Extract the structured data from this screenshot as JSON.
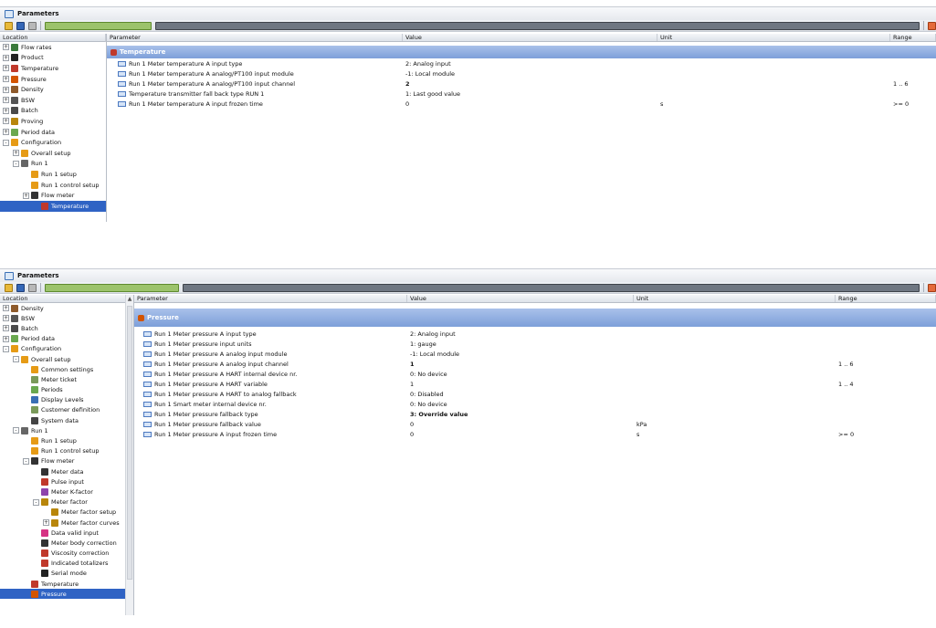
{
  "panels": [
    {
      "title": "Parameters",
      "tree_header": "Location",
      "tree_items": [
        {
          "label": "Flow rates",
          "level": 0,
          "expander": "+",
          "icon": "flow-icon",
          "color": "#3b7a3b"
        },
        {
          "label": "Product",
          "level": 0,
          "expander": "+",
          "icon": "product-icon",
          "color": "#222222"
        },
        {
          "label": "Temperature",
          "level": 0,
          "expander": "+",
          "icon": "thermometer-icon",
          "color": "#c0392b"
        },
        {
          "label": "Pressure",
          "level": 0,
          "expander": "+",
          "icon": "pressure-icon",
          "color": "#d35400"
        },
        {
          "label": "Density",
          "level": 0,
          "expander": "+",
          "icon": "density-icon",
          "color": "#8e5a2b"
        },
        {
          "label": "BSW",
          "level": 0,
          "expander": "+",
          "icon": "bsw-icon",
          "color": "#555555"
        },
        {
          "label": "Batch",
          "level": 0,
          "expander": "+",
          "icon": "batch-icon",
          "color": "#4a4a4a"
        },
        {
          "label": "Proving",
          "level": 0,
          "expander": "+",
          "icon": "proving-icon",
          "color": "#b8860b"
        },
        {
          "label": "Period data",
          "level": 0,
          "expander": "+",
          "icon": "period-icon",
          "color": "#6aa84f"
        },
        {
          "label": "Configuration",
          "level": 0,
          "expander": "-",
          "icon": "config-icon",
          "color": "#e69b16"
        },
        {
          "label": "Overall setup",
          "level": 1,
          "expander": "+",
          "icon": "config-icon",
          "color": "#e69b16"
        },
        {
          "label": "Run 1",
          "level": 1,
          "expander": "-",
          "icon": "run-icon",
          "color": "#666666"
        },
        {
          "label": "Run 1 setup",
          "level": 2,
          "expander": "",
          "icon": "config-icon",
          "color": "#e69b16"
        },
        {
          "label": "Run 1 control setup",
          "level": 2,
          "expander": "",
          "icon": "config-icon",
          "color": "#e69b16"
        },
        {
          "label": "Flow meter",
          "level": 2,
          "expander": "+",
          "icon": "flowmeter-icon",
          "color": "#333333"
        },
        {
          "label": "Temperature",
          "level": 3,
          "expander": "",
          "icon": "thermometer-icon",
          "color": "#c0392b",
          "selected": true
        }
      ],
      "grid_headers": [
        "Parameter",
        "Value",
        "Unit",
        "Range"
      ],
      "group": "Temperature",
      "rows": [
        {
          "param": "Run 1 Meter temperature A input type",
          "value": "2: Analog input",
          "unit": "",
          "range": "",
          "bold": false
        },
        {
          "param": "Run 1 Meter temperature A analog/PT100 input module",
          "value": "-1: Local module",
          "unit": "",
          "range": "",
          "bold": false
        },
        {
          "param": "Run 1 Meter temperature A analog/PT100 input channel",
          "value": "2",
          "unit": "",
          "range": "1 .. 6",
          "bold": true
        },
        {
          "param": "Temperature transmitter fall back type RUN 1",
          "value": "1: Last good value",
          "unit": "",
          "range": "",
          "bold": false
        },
        {
          "param": "Run 1 Meter temperature A input frozen time",
          "value": "0",
          "unit": "s",
          "range": ">= 0",
          "bold": false
        }
      ]
    },
    {
      "title": "Parameters",
      "tree_header": "Location",
      "tree_items": [
        {
          "label": "Density",
          "level": 0,
          "expander": "+",
          "icon": "density-icon",
          "color": "#8e5a2b"
        },
        {
          "label": "BSW",
          "level": 0,
          "expander": "+",
          "icon": "bsw-icon",
          "color": "#555555"
        },
        {
          "label": "Batch",
          "level": 0,
          "expander": "+",
          "icon": "batch-icon",
          "color": "#4a4a4a"
        },
        {
          "label": "Period data",
          "level": 0,
          "expander": "+",
          "icon": "period-icon",
          "color": "#6aa84f"
        },
        {
          "label": "Configuration",
          "level": 0,
          "expander": "-",
          "icon": "config-icon",
          "color": "#e69b16"
        },
        {
          "label": "Overall setup",
          "level": 1,
          "expander": "-",
          "icon": "config-icon",
          "color": "#e69b16"
        },
        {
          "label": "Common settings",
          "level": 2,
          "expander": "",
          "icon": "config-icon",
          "color": "#e69b16"
        },
        {
          "label": "Meter ticket",
          "level": 2,
          "expander": "",
          "icon": "document-icon",
          "color": "#7a9a5a"
        },
        {
          "label": "Periods",
          "level": 2,
          "expander": "",
          "icon": "period-icon",
          "color": "#6aa84f"
        },
        {
          "label": "Display Levels",
          "level": 2,
          "expander": "",
          "icon": "display-icon",
          "color": "#3a6fb5"
        },
        {
          "label": "Customer definition",
          "level": 2,
          "expander": "",
          "icon": "document-icon",
          "color": "#7a9a5a"
        },
        {
          "label": "System data",
          "level": 2,
          "expander": "",
          "icon": "system-icon",
          "color": "#444444"
        },
        {
          "label": "Run 1",
          "level": 1,
          "expander": "-",
          "icon": "run-icon",
          "color": "#666666"
        },
        {
          "label": "Run 1 setup",
          "level": 2,
          "expander": "",
          "icon": "config-icon",
          "color": "#e69b16"
        },
        {
          "label": "Run 1 control setup",
          "level": 2,
          "expander": "",
          "icon": "config-icon",
          "color": "#e69b16"
        },
        {
          "label": "Flow meter",
          "level": 2,
          "expander": "-",
          "icon": "flowmeter-icon",
          "color": "#333333"
        },
        {
          "label": "Meter data",
          "level": 3,
          "expander": "",
          "icon": "flowmeter-icon",
          "color": "#333333"
        },
        {
          "label": "Pulse input",
          "level": 3,
          "expander": "",
          "icon": "pulse-icon",
          "color": "#c0392b"
        },
        {
          "label": "Meter K-factor",
          "level": 3,
          "expander": "",
          "icon": "kfactor-icon",
          "color": "#8e44ad"
        },
        {
          "label": "Meter factor",
          "level": 3,
          "expander": "-",
          "icon": "meterfactor-icon",
          "color": "#b8860b"
        },
        {
          "label": "Meter factor setup",
          "level": 4,
          "expander": "",
          "icon": "meterfactor-icon",
          "color": "#b8860b"
        },
        {
          "label": "Meter factor curves",
          "level": 4,
          "expander": "+",
          "icon": "meterfactor-icon",
          "color": "#b8860b"
        },
        {
          "label": "Data valid input",
          "level": 3,
          "expander": "",
          "icon": "datavalid-icon",
          "color": "#d63384"
        },
        {
          "label": "Meter body correction",
          "level": 3,
          "expander": "",
          "icon": "flowmeter-icon",
          "color": "#333333"
        },
        {
          "label": "Viscosity correction",
          "level": 3,
          "expander": "",
          "icon": "viscosity-icon",
          "color": "#c0392b"
        },
        {
          "label": "Indicated totalizers",
          "level": 3,
          "expander": "",
          "icon": "totalizer-icon",
          "color": "#c0392b"
        },
        {
          "label": "Serial mode",
          "level": 3,
          "expander": "",
          "icon": "serial-icon",
          "color": "#222222"
        },
        {
          "label": "Temperature",
          "level": 2,
          "expander": "",
          "icon": "thermometer-icon",
          "color": "#c0392b"
        },
        {
          "label": "Pressure",
          "level": 2,
          "expander": "",
          "icon": "pressure-icon",
          "color": "#d35400",
          "selected": true
        }
      ],
      "grid_headers": [
        "Parameter",
        "Value",
        "Unit",
        "Range"
      ],
      "group": "Pressure",
      "rows": [
        {
          "param": "Run 1 Meter pressure A input type",
          "value": "2: Analog input",
          "unit": "",
          "range": "",
          "bold": false
        },
        {
          "param": "Run 1 Meter pressure input units",
          "value": "1: gauge",
          "unit": "",
          "range": "",
          "bold": false
        },
        {
          "param": "Run 1 Meter pressure A analog input module",
          "value": "-1: Local module",
          "unit": "",
          "range": "",
          "bold": false
        },
        {
          "param": "Run 1 Meter pressure A analog input channel",
          "value": "1",
          "unit": "",
          "range": "1 .. 6",
          "bold": true
        },
        {
          "param": "Run 1 Meter pressure A HART internal device nr.",
          "value": "0: No device",
          "unit": "",
          "range": "",
          "bold": false
        },
        {
          "param": "Run 1 Meter pressure A HART variable",
          "value": "1",
          "unit": "",
          "range": "1 .. 4",
          "bold": false
        },
        {
          "param": "Run 1 Meter pressure A HART to analog fallback",
          "value": "0: Disabled",
          "unit": "",
          "range": "",
          "bold": false
        },
        {
          "param": "Run 1 Smart meter internal device nr.",
          "value": "0: No device",
          "unit": "",
          "range": "",
          "bold": false
        },
        {
          "param": "Run 1 Meter pressure fallback type",
          "value": "3: Override value",
          "unit": "",
          "range": "",
          "bold": true
        },
        {
          "param": "Run 1 Meter pressure fallback value",
          "value": "0",
          "unit": "kPa",
          "range": "",
          "bold": false
        },
        {
          "param": "Run 1 Meter pressure A input frozen time",
          "value": "0",
          "unit": "s",
          "range": ">= 0",
          "bold": false
        }
      ]
    }
  ],
  "colors": {
    "group_bar": "#7d9fd9",
    "selection": "#2f63c4"
  }
}
